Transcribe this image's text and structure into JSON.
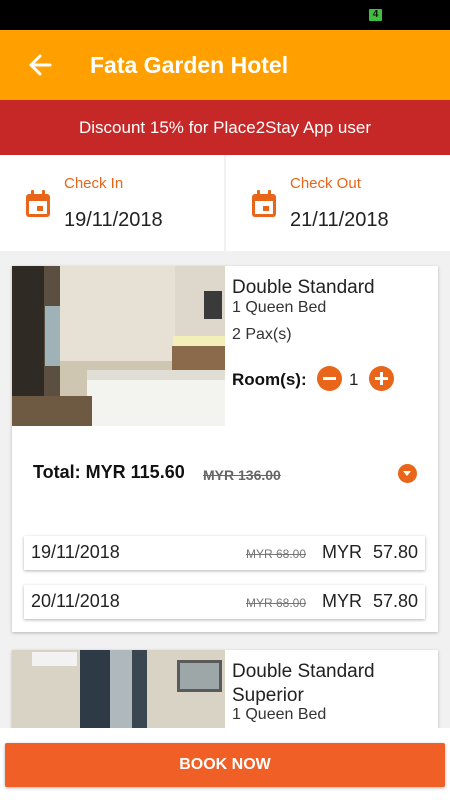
{
  "status_bar": {
    "battery_text": "4"
  },
  "header": {
    "title": "Fata Garden Hotel",
    "back_icon": "arrow-left-icon"
  },
  "promo": {
    "text": "Discount 15% for Place2Stay App user"
  },
  "dates": {
    "check_in": {
      "label": "Check In",
      "value": "19/11/2018"
    },
    "check_out": {
      "label": "Check Out",
      "value": "21/11/2018"
    }
  },
  "rooms": [
    {
      "name": "Double Standard",
      "bed": "1 Queen Bed",
      "pax": "2 Pax(s)",
      "rooms_label": "Room(s):",
      "quantity": "1",
      "total_label": "Total: MYR 115.60",
      "total_old": "MYR 136.00",
      "nights": [
        {
          "date": "19/11/2018",
          "old_price": "MYR 68.00",
          "price": "MYR 57.80"
        },
        {
          "date": "20/11/2018",
          "old_price": "MYR 68.00",
          "price": "MYR 57.80"
        }
      ]
    },
    {
      "name": "Double Standard Superior",
      "bed": "1 Queen Bed"
    }
  ],
  "footer": {
    "book_label": "BOOK NOW"
  },
  "colors": {
    "app_bar": "#ffa000",
    "promo": "#c62828",
    "accent": "#e8651a",
    "book": "#ef5f26"
  }
}
